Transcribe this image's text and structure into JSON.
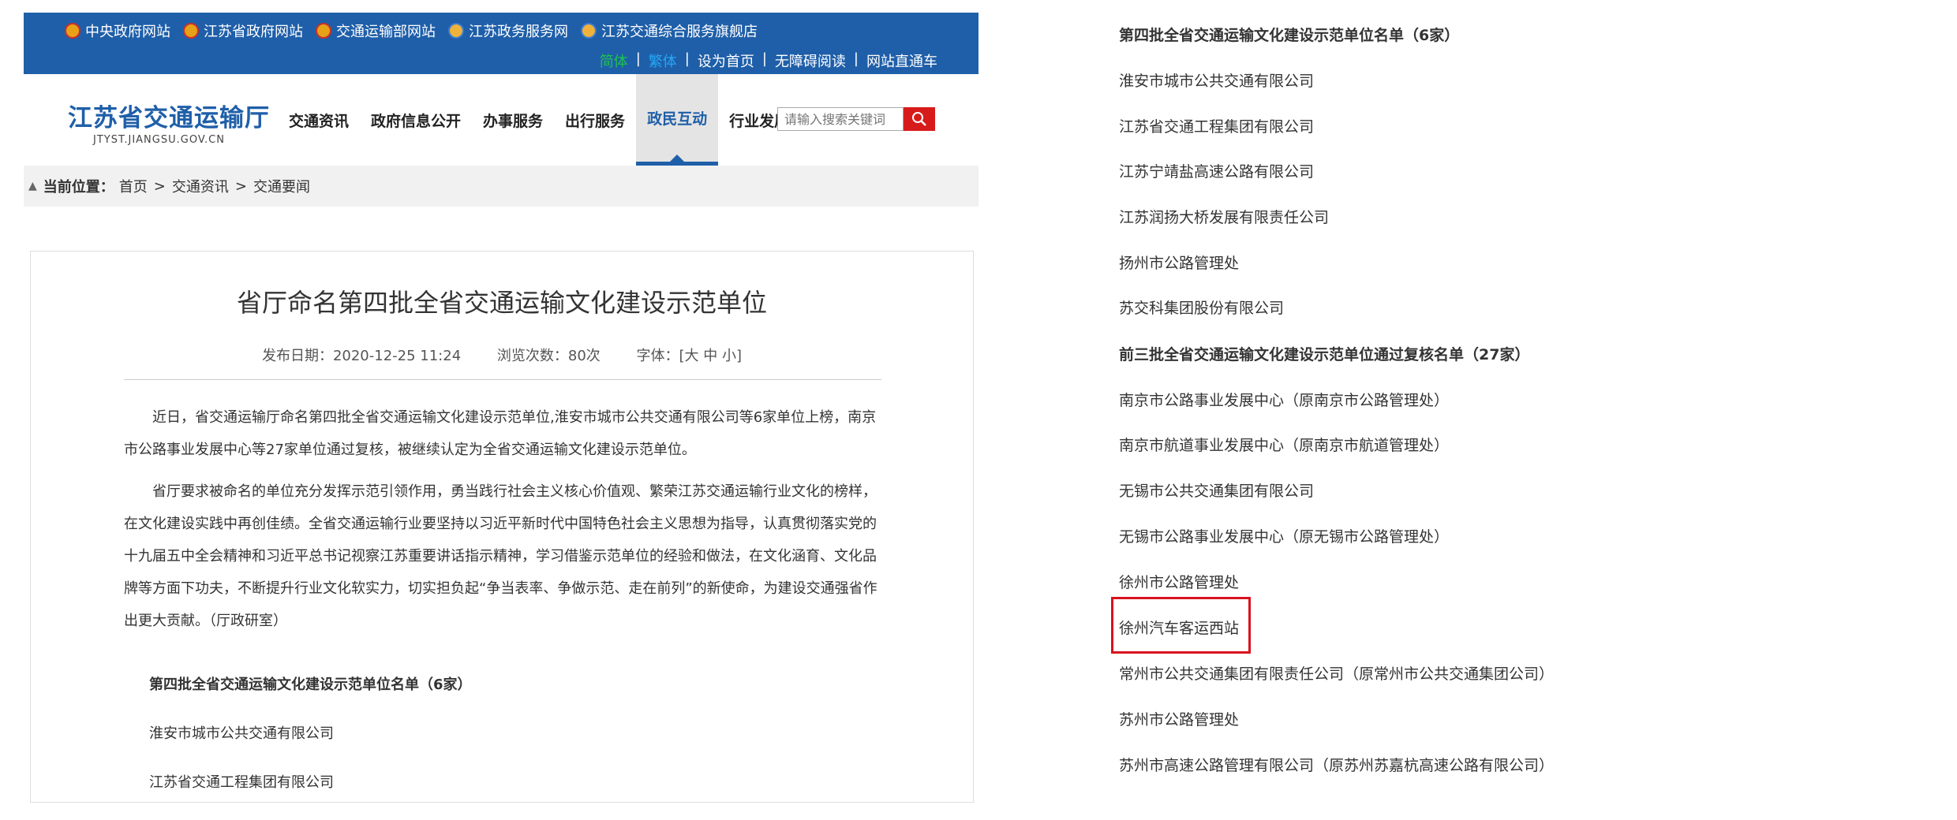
{
  "topbar": {
    "links": [
      "中央政府网站",
      "江苏省政府网站",
      "交通运输部网站",
      "江苏政务服务网",
      "江苏交通综合服务旗舰店"
    ],
    "lang_simplified": "简体",
    "lang_traditional": "繁体",
    "set_home": "设为首页",
    "accessibility": "无障碍阅读",
    "site_nav": "网站直通车",
    "separator": "|"
  },
  "header": {
    "logo_title": "江苏省交通运输厅",
    "logo_subtitle": "JTYST.JIANGSU.GOV.CN",
    "nav": [
      "交通资讯",
      "政府信息公开",
      "办事服务",
      "出行服务",
      "政民互动",
      "行业发展"
    ],
    "active_nav": "政民互动",
    "search_placeholder": "请输入搜索关键词"
  },
  "breadcrumb": {
    "label": "当前位置：",
    "items": [
      "首页",
      "交通资讯",
      "交通要闻"
    ],
    "sep": ">"
  },
  "article": {
    "title": "省厅命名第四批全省交通运输文化建设示范单位",
    "publish_date": "发布日期：2020-12-25 11:24",
    "views": "浏览次数：80次",
    "font_size": "字体：[大 中 小]",
    "paragraph1": "近日，省交通运输厅命名第四批全省交通运输文化建设示范单位,淮安市城市公共交通有限公司等6家单位上榜，南京市公路事业发展中心等27家单位通过复核，被继续认定为全省交通运输文化建设示范单位。",
    "paragraph2": "省厅要求被命名的单位充分发挥示范引领作用，勇当践行社会主义核心价值观、繁荣江苏交通运输行业文化的榜样，在文化建设实践中再创佳绩。全省交通运输行业要坚持以习近平新时代中国特色社会主义思想为指导，认真贯彻落实党的十九届五中全会精神和习近平总书记视察江苏重要讲话指示精神，学习借鉴示范单位的经验和做法，在文化涵育、文化品牌等方面下功夫，不断提升行业文化软实力，切实担负起“争当表率、争做示范、走在前列”的新使命，为建设交通强省作出更大贡献。（厅政研室）",
    "list_heading": "第四批全省交通运输文化建设示范单位名单（6家）",
    "list_items": [
      "淮安市城市公共交通有限公司",
      "江苏省交通工程集团有限公司"
    ]
  },
  "right_list": {
    "rows": [
      {
        "text": "第四批全省交通运输文化建设示范单位名单（6家）",
        "heading": true
      },
      {
        "text": "淮安市城市公共交通有限公司",
        "heading": false
      },
      {
        "text": "江苏省交通工程集团有限公司",
        "heading": false
      },
      {
        "text": "江苏宁靖盐高速公路有限公司",
        "heading": false
      },
      {
        "text": "江苏润扬大桥发展有限责任公司",
        "heading": false
      },
      {
        "text": "扬州市公路管理处",
        "heading": false
      },
      {
        "text": "苏交科集团股份有限公司",
        "heading": false
      },
      {
        "text": "前三批全省交通运输文化建设示范单位通过复核名单（27家）",
        "heading": true
      },
      {
        "text": "南京市公路事业发展中心（原南京市公路管理处）",
        "heading": false
      },
      {
        "text": "南京市航道事业发展中心（原南京市航道管理处）",
        "heading": false
      },
      {
        "text": "无锡市公共交通集团有限公司",
        "heading": false
      },
      {
        "text": "无锡市公路事业发展中心（原无锡市公路管理处）",
        "heading": false
      },
      {
        "text": "徐州市公路管理处",
        "heading": false
      },
      {
        "text": "徐州汽车客运西站",
        "heading": false
      },
      {
        "text": "常州市公共交通集团有限责任公司（原常州市公共交通集团公司）",
        "heading": false
      },
      {
        "text": "苏州市公路管理处",
        "heading": false
      },
      {
        "text": "苏州市高速公路管理有限公司（原苏州苏嘉杭高速公路有限公司）",
        "heading": false
      }
    ],
    "highlighted": "徐州汽车客运西站"
  },
  "colors": {
    "topbar_bg": "#1f5fa9",
    "brand_blue": "#1f5fa9",
    "search_red": "#d71b1b",
    "highlight_red": "#d9121e"
  }
}
